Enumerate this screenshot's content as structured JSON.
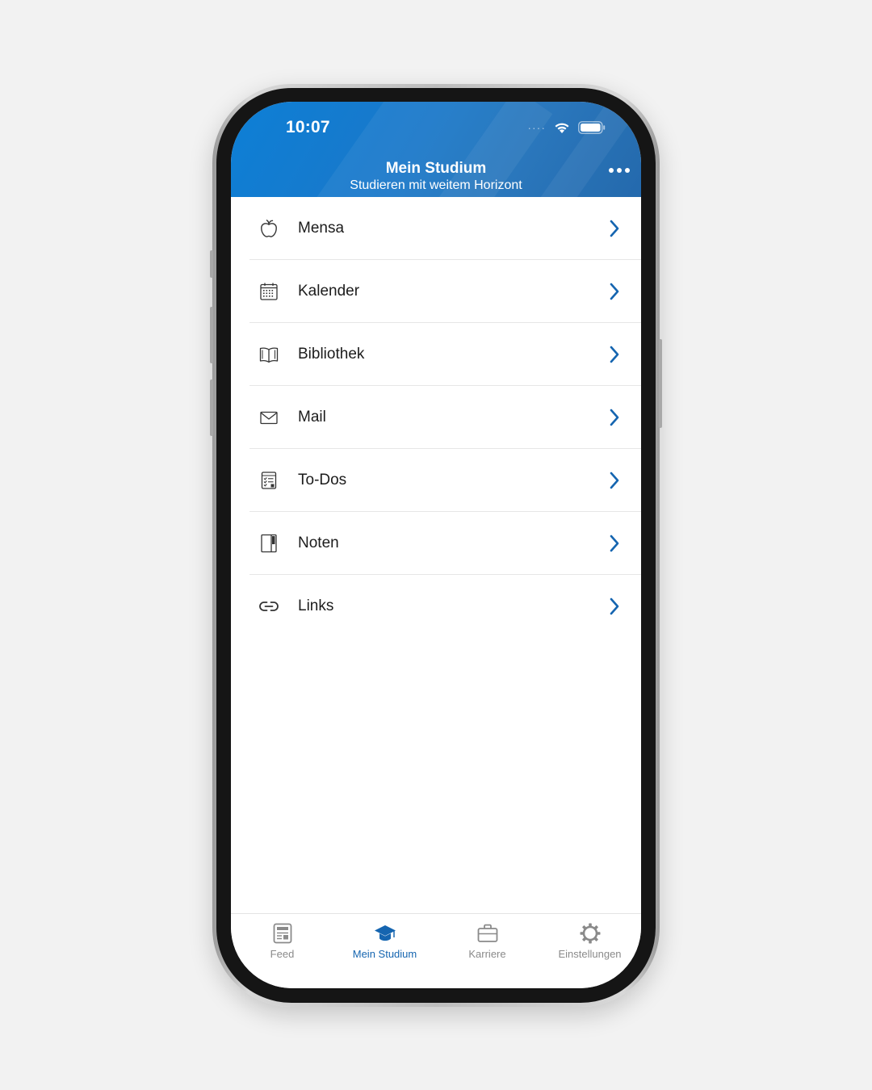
{
  "status_bar": {
    "time": "10:07"
  },
  "header": {
    "title": "Mein Studium",
    "subtitle": "Studieren mit weitem Horizont"
  },
  "menu": {
    "items": [
      {
        "label": "Mensa",
        "icon": "apple-icon"
      },
      {
        "label": "Kalender",
        "icon": "calendar-icon"
      },
      {
        "label": "Bibliothek",
        "icon": "book-icon"
      },
      {
        "label": "Mail",
        "icon": "mail-icon"
      },
      {
        "label": "To-Dos",
        "icon": "checklist-icon"
      },
      {
        "label": "Noten",
        "icon": "notebook-icon"
      },
      {
        "label": "Links",
        "icon": "link-icon"
      }
    ]
  },
  "tabbar": {
    "tabs": [
      {
        "label": "Feed",
        "icon": "newspaper-icon",
        "active": false
      },
      {
        "label": "Mein Studium",
        "icon": "graduation-cap-icon",
        "active": true
      },
      {
        "label": "Karriere",
        "icon": "briefcase-icon",
        "active": false
      },
      {
        "label": "Einstellungen",
        "icon": "gear-icon",
        "active": false
      }
    ]
  },
  "colors": {
    "header_blue": "#1a78c9",
    "accent_blue": "#1565b0",
    "chevron_blue": "#1565b0",
    "inactive_gray": "#8a8a8a",
    "background": "#f2f2f2"
  }
}
